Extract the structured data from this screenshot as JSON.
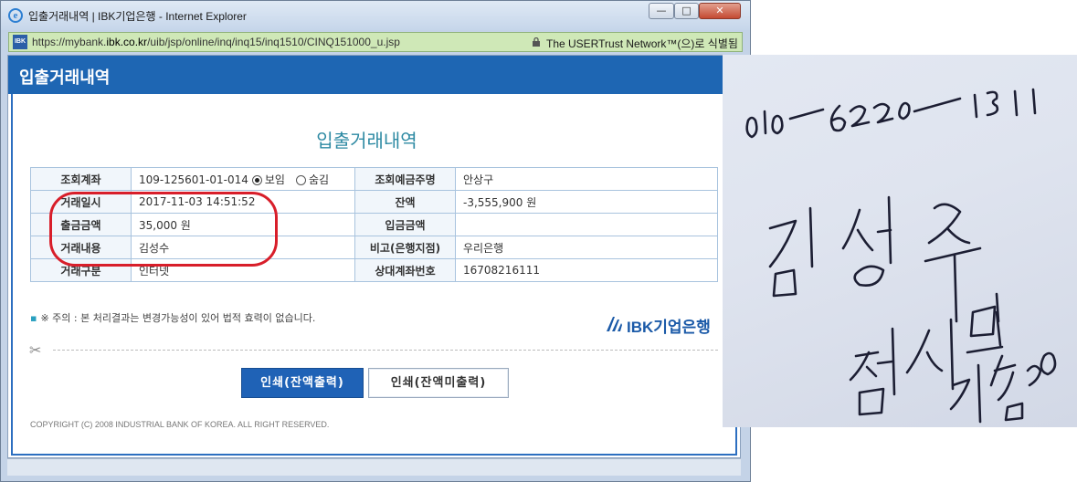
{
  "window": {
    "title": "입출거래내역 | IBK기업은행 - Internet Explorer",
    "ie_icon_letter": "e",
    "minimize_glyph": "—",
    "maximize_glyph": "□",
    "close_glyph": "✕"
  },
  "address_bar": {
    "site_icon_text": "IBK",
    "url_scheme": "https://mybank.",
    "url_host": "ibk.co.kr",
    "url_path": "/uib/jsp/online/inq/inq15/inq1510/CINQ151000_u.jsp",
    "certificate": "The USERTrust Network™(으)로 식별됨"
  },
  "page": {
    "header_title": "입출거래내역",
    "heading": "입출거래내역"
  },
  "table": {
    "rows": [
      {
        "l1": "조회계좌",
        "v1": "109-125601-01-014",
        "l2": "조회예금주명",
        "v2": "안상구"
      },
      {
        "l1": "거래일시",
        "v1": "2017-11-03 14:51:52",
        "l2": "잔액",
        "v2": "-3,555,900 원"
      },
      {
        "l1": "출금금액",
        "v1": "35,000 원",
        "l2": "입금금액",
        "v2": ""
      },
      {
        "l1": "거래내용",
        "v1": "김성수",
        "l2": "비고(은행지점)",
        "v2": "우리은행"
      },
      {
        "l1": "거래구분",
        "v1": "인터넷",
        "l2": "상대계좌번호",
        "v2": "16708216111"
      }
    ],
    "radio_show_label": "보임",
    "radio_hide_label": "숨김"
  },
  "notice": {
    "bullet": "▪",
    "text": "※ 주의 : 본 처리결과는 변경가능성이 있어 법적 효력이 없습니다."
  },
  "logo": {
    "text": "IBK기업은행",
    "color": "#1b5aa8"
  },
  "scissors_glyph": "✂",
  "buttons": {
    "print_balance": "인쇄(잔액출력)",
    "print_no_balance": "인쇄(잔액미출력)"
  },
  "copyright": "COPYRIGHT (C) 2008 INDUSTRIAL BANK OF KOREA. ALL RIGHT RESERVED.",
  "colors": {
    "header_blue": "#1e66b3",
    "highlight_red": "#d81e2a",
    "heading_teal": "#2e8aa3",
    "address_green": "#cfe8b7"
  }
}
